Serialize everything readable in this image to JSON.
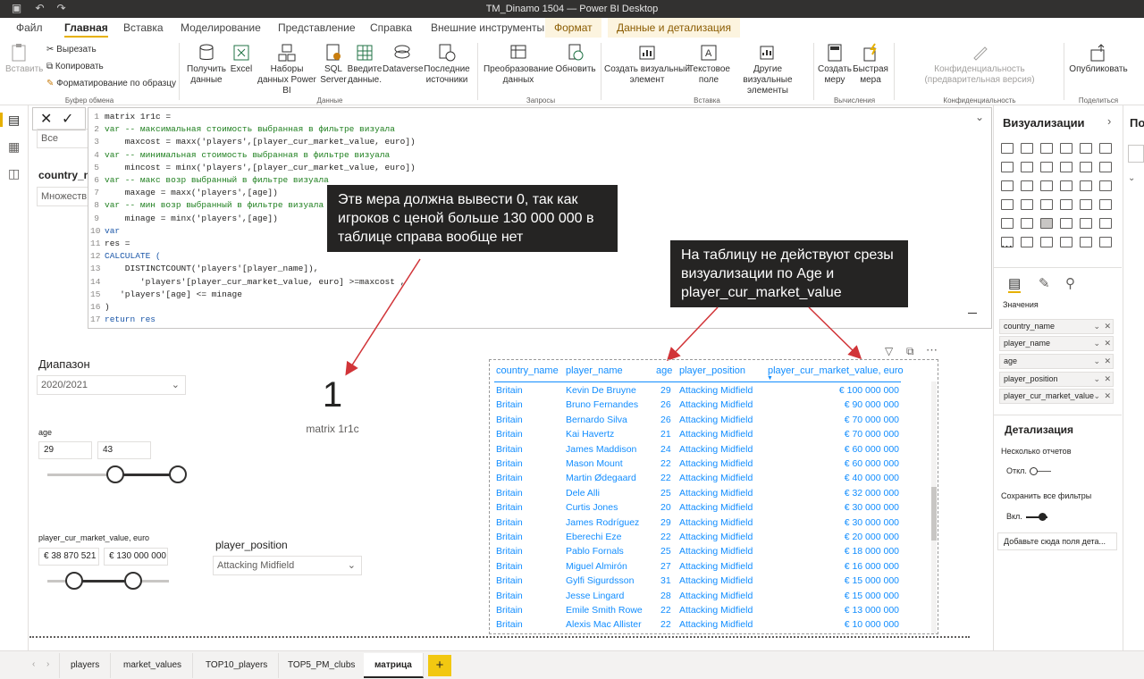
{
  "window": {
    "title": "TM_Dinamo 1504 — Power BI Desktop"
  },
  "menu": {
    "tabs": [
      "Файл",
      "Главная",
      "Вставка",
      "Моделирование",
      "Представление",
      "Справка",
      "Внешние инструменты",
      "Формат",
      "Данные и детализация"
    ]
  },
  "ribbon": {
    "clipboard": {
      "paste": "Вставить",
      "cut": "Вырезать",
      "copy": "Копировать",
      "format_painter": "Форматирование по образцу",
      "group": "Буфер обмена"
    },
    "data": {
      "get_data": "Получить данные",
      "excel": "Excel",
      "datasets": "Наборы данных Power BI",
      "sql": "SQL Server",
      "enter_data": "Введите данные.",
      "dataverse": "Dataverse",
      "recent": "Последние источники",
      "group": "Данные"
    },
    "queries": {
      "transform": "Преобразование данных",
      "refresh": "Обновить",
      "group": "Запросы"
    },
    "insert": {
      "new_visual": "Создать визуальный элемент",
      "text_box": "Текстовое поле",
      "more_visuals": "Другие визуальные элементы",
      "group": "Вставка"
    },
    "calc": {
      "new_measure": "Создать меру",
      "quick_measure": "Быстрая мера",
      "group": "Вычисления"
    },
    "sensitivity": {
      "label": "Конфиденциальность (предварительная версия)",
      "group": "Конфиденциальность"
    },
    "share": {
      "publish": "Опубликовать",
      "group": "Поделиться"
    }
  },
  "left_filter": {
    "all": "Все",
    "country_label": "country_na",
    "multiple": "Множеств"
  },
  "dax": {
    "lines": [
      "matrix 1r1c =",
      "var -- максимальная стоимость выбранная в фильтре визуала",
      "    maxcost = maxx('players',[player_cur_market_value, euro])",
      "var -- минимальная стоимость выбранная в фильтре визуала",
      "    mincost = minx('players',[player_cur_market_value, euro])",
      "var -- макс возр выбранный в фильтре визуала",
      "    maxage = maxx('players',[age])",
      "var -- мин возр выбранный в фильтре визуала",
      "    minage = minx('players',[age])",
      "var",
      "res =",
      "CALCULATE (",
      "    DISTINCTCOUNT('players'[player_name]),",
      "       'players'[player_cur_market_value, euro] >=maxcost ,",
      "   'players'[age] <= minage",
      ")",
      "return res"
    ],
    "line_numbers": [
      "1",
      "2",
      "3",
      "4",
      "5",
      "6",
      "7",
      "8",
      "9",
      "10",
      "11",
      "12",
      "13",
      "14",
      "15",
      "16",
      "17"
    ]
  },
  "callouts": {
    "c1": "Этв мера должна вывести 0, так как игроков с ценой больше 130 000 000 в таблице справа вообще нет",
    "c2": "На таблицу не действуют срезы визуализации по Age и player_cur_market_value"
  },
  "card": {
    "value": "1",
    "label": "matrix 1r1c"
  },
  "slicers": {
    "range": {
      "title": "Диапазон",
      "value": "2020/2021"
    },
    "age": {
      "title": "age",
      "min": "29",
      "max": "43"
    },
    "cost": {
      "title": "player_cur_market_value, euro",
      "min": "€ 38 870 521",
      "max": "€ 130 000 000"
    },
    "position": {
      "title": "player_position",
      "value": "Attacking Midfield"
    }
  },
  "table": {
    "headers": [
      "country_name",
      "player_name",
      "age",
      "player_position",
      "player_cur_market_value, euro"
    ],
    "rows": [
      [
        "Britain",
        "Kevin De Bruyne",
        "29",
        "Attacking Midfield",
        "€ 100 000 000"
      ],
      [
        "Britain",
        "Bruno Fernandes",
        "26",
        "Attacking Midfield",
        "€ 90 000 000"
      ],
      [
        "Britain",
        "Bernardo Silva",
        "26",
        "Attacking Midfield",
        "€ 70 000 000"
      ],
      [
        "Britain",
        "Kai Havertz",
        "21",
        "Attacking Midfield",
        "€ 70 000 000"
      ],
      [
        "Britain",
        "James Maddison",
        "24",
        "Attacking Midfield",
        "€ 60 000 000"
      ],
      [
        "Britain",
        "Mason Mount",
        "22",
        "Attacking Midfield",
        "€ 60 000 000"
      ],
      [
        "Britain",
        "Martin Ødegaard",
        "22",
        "Attacking Midfield",
        "€ 40 000 000"
      ],
      [
        "Britain",
        "Dele Alli",
        "25",
        "Attacking Midfield",
        "€ 32 000 000"
      ],
      [
        "Britain",
        "Curtis Jones",
        "20",
        "Attacking Midfield",
        "€ 30 000 000"
      ],
      [
        "Britain",
        "James Rodríguez",
        "29",
        "Attacking Midfield",
        "€ 30 000 000"
      ],
      [
        "Britain",
        "Eberechi Eze",
        "22",
        "Attacking Midfield",
        "€ 20 000 000"
      ],
      [
        "Britain",
        "Pablo Fornals",
        "25",
        "Attacking Midfield",
        "€ 18 000 000"
      ],
      [
        "Britain",
        "Miguel Almirón",
        "27",
        "Attacking Midfield",
        "€ 16 000 000"
      ],
      [
        "Britain",
        "Gylfi Sigurdsson",
        "31",
        "Attacking Midfield",
        "€ 15 000 000"
      ],
      [
        "Britain",
        "Jesse Lingard",
        "28",
        "Attacking Midfield",
        "€ 15 000 000"
      ],
      [
        "Britain",
        "Emile Smith Rowe",
        "22",
        "Attacking Midfield",
        "€ 13 000 000"
      ],
      [
        "Britain",
        "Alexis Mac Allister",
        "22",
        "Attacking Midfield",
        "€ 10 000 000"
      ]
    ]
  },
  "viz_pane": {
    "title": "Визуализации",
    "values_label": "Значения",
    "fields": [
      "country_name",
      "player_name",
      "age",
      "player_position",
      "player_cur_market_value"
    ],
    "drill": "Детализация",
    "cross_report": "Несколько отчетов",
    "off": "Откл.",
    "keep_filters": "Сохранить все фильтры",
    "on": "Вкл.",
    "add_drill": "Добавьте сюда поля дета...",
    "next_pane": "По"
  },
  "pages": [
    "players",
    "market_values",
    "TOP10_players",
    "TOP5_PM_clubs",
    "матрица"
  ],
  "colors": {
    "accent": "#118dff",
    "titlebar": "#323130",
    "highlight": "#e6b000"
  }
}
